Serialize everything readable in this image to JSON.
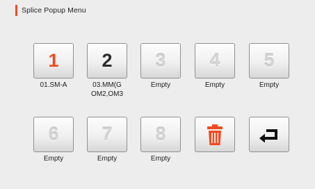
{
  "title": "Splice Popup Menu",
  "colors": {
    "accent": "#ef4b22",
    "slot1_number": "#f04a1e",
    "slot2_number": "#2b2b2b",
    "empty_number": "#d4d4d4",
    "trash_icon": "#f04a1e",
    "back_icon": "#111111"
  },
  "slots": [
    {
      "number": "1",
      "label": "01.SM-A",
      "state": "active"
    },
    {
      "number": "2",
      "label": "03.MM(G\nOM2,OM3",
      "state": "active"
    },
    {
      "number": "3",
      "label": "Empty",
      "state": "empty"
    },
    {
      "number": "4",
      "label": "Empty",
      "state": "empty"
    },
    {
      "number": "5",
      "label": "Empty",
      "state": "empty"
    },
    {
      "number": "6",
      "label": "Empty",
      "state": "empty"
    },
    {
      "number": "7",
      "label": "Empty",
      "state": "empty"
    },
    {
      "number": "8",
      "label": "Empty",
      "state": "empty"
    }
  ],
  "actions": {
    "delete_icon": "trash-icon",
    "back_icon": "return-arrow-icon"
  }
}
